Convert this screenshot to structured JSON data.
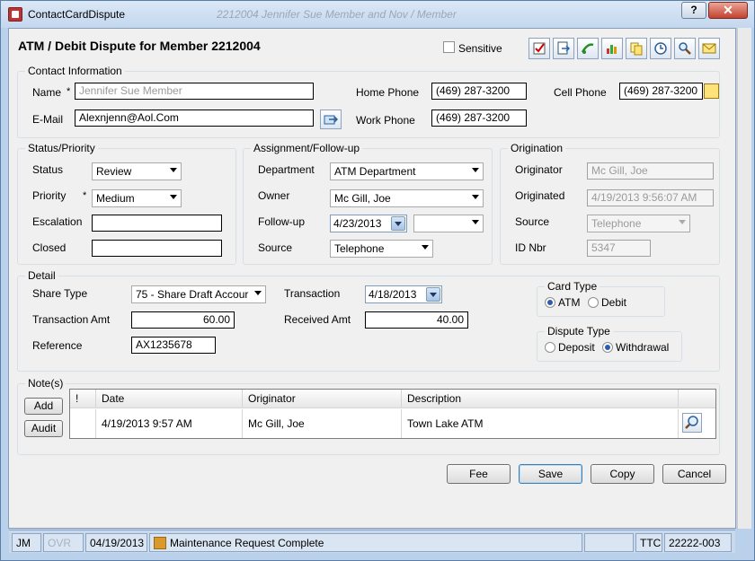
{
  "window": {
    "title": "ContactCardDispute",
    "faded_title": "2212004 Jennifer Sue Member and Nov / Member",
    "help_label": "?",
    "close_label": "✕"
  },
  "header": {
    "title": "ATM / Debit Dispute for Member 2212004",
    "sensitive_label": "Sensitive",
    "sensitive_checked": false,
    "toolbar_icons": [
      "checklist-icon",
      "export-icon",
      "transfer-icon",
      "chart-icon",
      "copy-icon",
      "clock-icon",
      "search-icon",
      "mail-icon"
    ]
  },
  "contact": {
    "group_label": "Contact Information",
    "name_label": "Name",
    "name_placeholder": "Jennifer Sue Member",
    "email_label": "E-Mail",
    "email_value": "Alexnjenn@Aol.Com",
    "home_phone_label": "Home Phone",
    "home_phone_value": "(469) 287-3200",
    "work_phone_label": "Work Phone",
    "work_phone_value": "(469) 287-3200",
    "cell_phone_label": "Cell Phone",
    "cell_phone_value": "(469) 287-3200"
  },
  "status_priority": {
    "group_label": "Status/Priority",
    "status_label": "Status",
    "status_value": "Review",
    "priority_label": "Priority",
    "priority_value": "Medium",
    "escalation_label": "Escalation",
    "escalation_value": "",
    "closed_label": "Closed",
    "closed_value": ""
  },
  "assignment": {
    "group_label": "Assignment/Follow-up",
    "department_label": "Department",
    "department_value": "ATM Department",
    "owner_label": "Owner",
    "owner_value": "Mc Gill, Joe",
    "followup_label": "Follow-up",
    "followup_date": "4/23/2013",
    "followup_time": "",
    "source_label": "Source",
    "source_value": "Telephone"
  },
  "origination": {
    "group_label": "Origination",
    "originator_label": "Originator",
    "originator_value": "Mc Gill, Joe",
    "originated_label": "Originated",
    "originated_value": "4/19/2013 9:56:07 AM",
    "source_label": "Source",
    "source_value": "Telephone",
    "id_label": "ID Nbr",
    "id_value": "5347"
  },
  "detail": {
    "group_label": "Detail",
    "share_type_label": "Share Type",
    "share_type_value": "75 - Share Draft Accour",
    "transaction_label": "Transaction",
    "transaction_value": "4/18/2013",
    "transaction_amt_label": "Transaction Amt",
    "transaction_amt_value": "60.00",
    "received_amt_label": "Received Amt",
    "received_amt_value": "40.00",
    "reference_label": "Reference",
    "reference_value": "AX1235678",
    "card_type_label": "Card Type",
    "card_type_atm": "ATM",
    "card_type_debit": "Debit",
    "card_type_selected": "ATM",
    "dispute_type_label": "Dispute Type",
    "dispute_deposit": "Deposit",
    "dispute_withdrawal": "Withdrawal",
    "dispute_selected": "Withdrawal"
  },
  "notes": {
    "group_label": "Note(s)",
    "add_label": "Add",
    "audit_label": "Audit",
    "columns": [
      "!",
      "Date",
      "Originator",
      "Description",
      ""
    ],
    "rows": [
      {
        "flag": "",
        "date": "4/19/2013 9:57 AM",
        "originator": "Mc Gill, Joe",
        "description": "Town Lake ATM"
      }
    ]
  },
  "buttons": {
    "fee": "Fee",
    "save": "Save",
    "copy": "Copy",
    "cancel": "Cancel"
  },
  "statusbar": {
    "user": "JM",
    "ovr": "OVR",
    "date": "04/19/2013",
    "message": "Maintenance Request Complete",
    "blank": "",
    "branch": "TTC",
    "code": "22222-003"
  }
}
